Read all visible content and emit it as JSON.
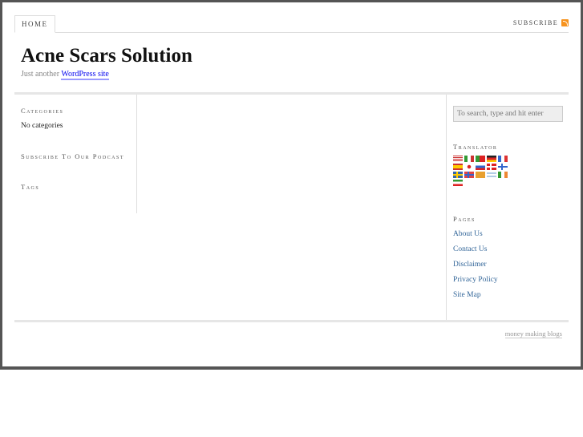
{
  "nav": {
    "home": "HOME",
    "subscribe": "SUBSCRIBE"
  },
  "header": {
    "title": "Acne Scars Solution",
    "tagline_prefix": "Just another",
    "tagline_link": "WordPress site"
  },
  "left_sidebar": {
    "categories_heading": "Categories",
    "categories_empty": "No categories",
    "podcast_heading": "Subscribe To Our Podcast",
    "tags_heading": "Tags"
  },
  "right_sidebar": {
    "search_placeholder": "To search, type and hit enter",
    "translator_heading": "Translator",
    "flags": [
      "us",
      "it",
      "pt",
      "de",
      "fr",
      "es",
      "jp",
      "ru",
      "dk",
      "fi",
      "se",
      "no",
      "cn",
      "il",
      "ie",
      "ir"
    ],
    "pages_heading": "Pages",
    "pages": [
      "About Us",
      "Contact Us",
      "Disclaimer",
      "Privacy Policy",
      "Site Map"
    ]
  },
  "footer": {
    "link": "money making blogs"
  }
}
